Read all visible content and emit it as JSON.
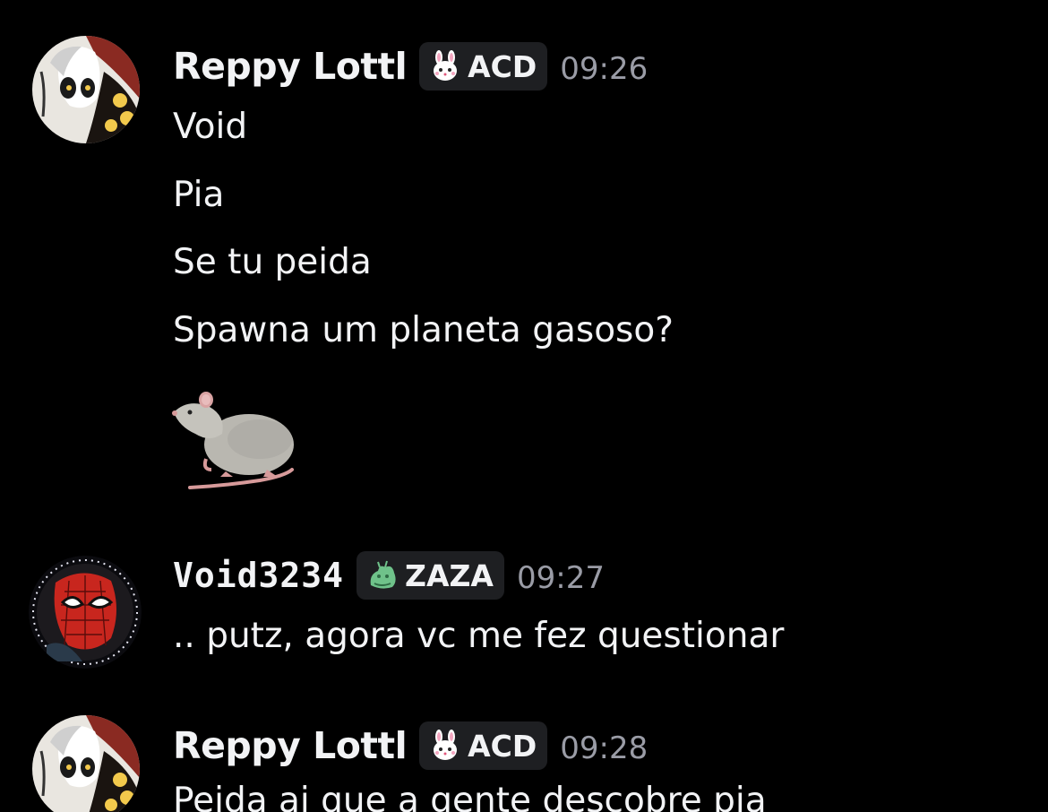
{
  "messages": [
    {
      "author": "Reppy Lottl",
      "tag": {
        "icon": "bunny-icon",
        "label": "ACD"
      },
      "time": "09:26",
      "lines": [
        "Void",
        "Pia",
        "Se tu peida",
        "Spawna um planeta gasoso?"
      ],
      "attachment": "rat-emoji"
    },
    {
      "author": "Void3234",
      "tag": {
        "icon": "green-blob-icon",
        "label": "ZAZA"
      },
      "time": "09:27",
      "lines": [
        ".. putz, agora vc me fez questionar"
      ]
    },
    {
      "author": "Reppy Lottl",
      "tag": {
        "icon": "bunny-icon",
        "label": "ACD"
      },
      "time": "09:28",
      "lines": [
        "Peida ai que a gente descobre pia"
      ]
    }
  ],
  "colors": {
    "background": "#000000",
    "text": "#f2f3f5",
    "timestamp": "#9a9ca6",
    "tag_bg": "#1e1f22"
  }
}
